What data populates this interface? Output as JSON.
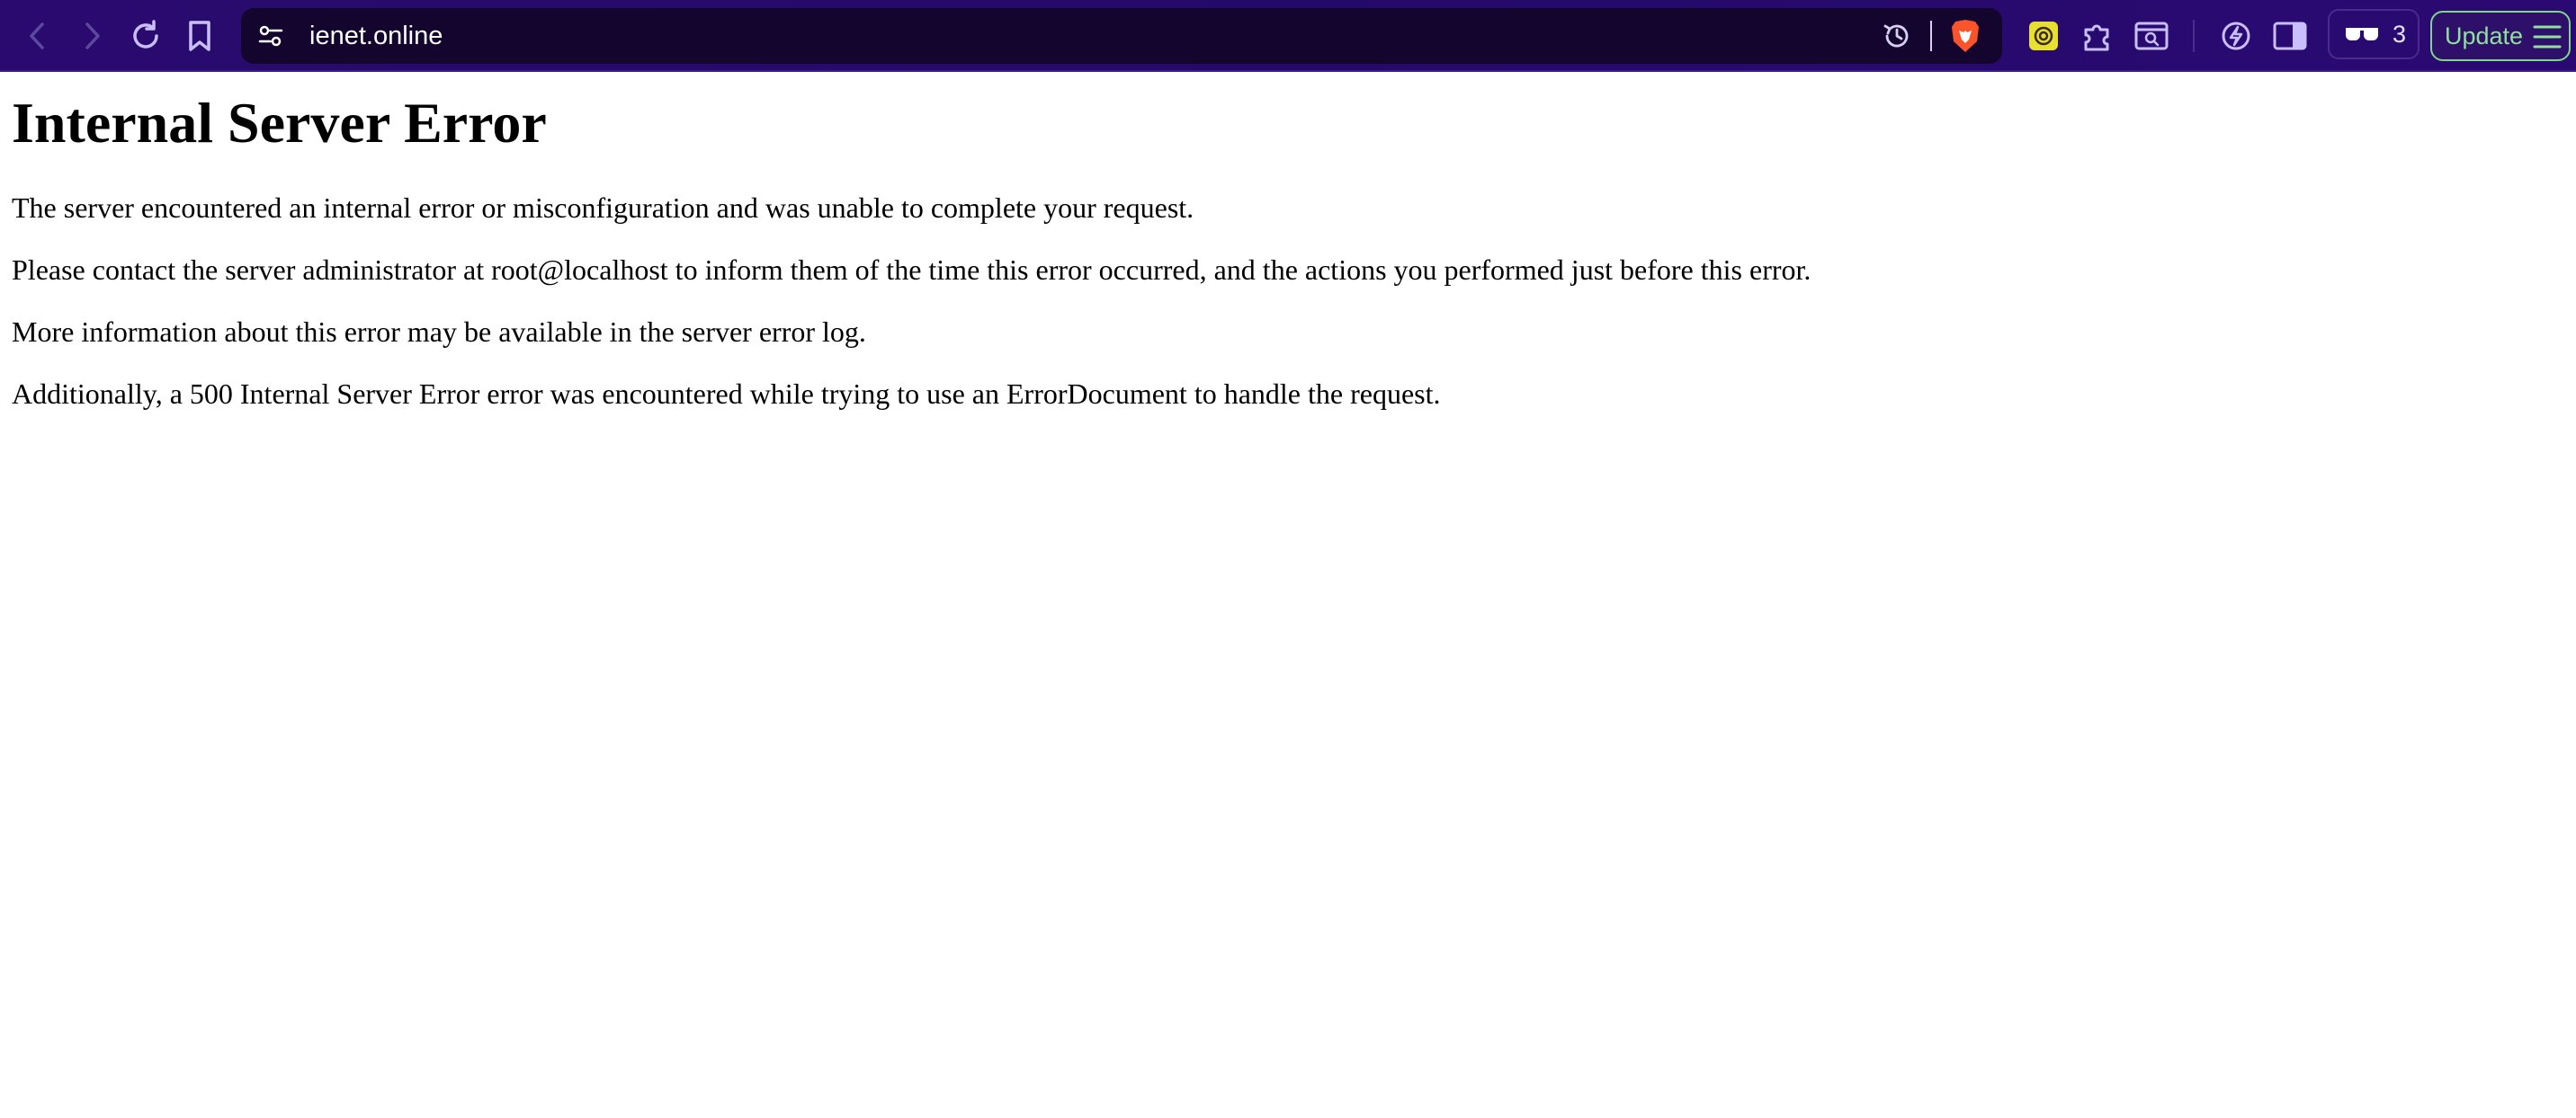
{
  "browser": {
    "url": "ienet.online",
    "icons": {
      "back": "chevron-left-icon",
      "forward": "chevron-right-icon",
      "reload": "reload-icon",
      "bookmark": "bookmark-icon",
      "site_settings": "tune-icon",
      "history": "history-clock-icon",
      "brave_shields": "brave-lion-icon",
      "wallet": "wallet-icon",
      "extensions": "puzzle-icon",
      "screenshot": "screenshot-search-icon",
      "leo": "leo-ai-icon",
      "sidebar": "sidebar-icon",
      "reader": "glasses-icon",
      "menu": "hamburger-icon"
    },
    "reader_count": "3",
    "update_label": "Update",
    "colors": {
      "toolbar": "#2a0a6e",
      "urlbar": "#14052f",
      "update_accent": "#8fe09a",
      "wallet_bg": "#e8e030",
      "brave_orange": "#fb542b"
    }
  },
  "page": {
    "title": "Internal Server Error",
    "paragraphs": [
      "The server encountered an internal error or misconfiguration and was unable to complete your request.",
      "Please contact the server administrator at root@localhost to inform them of the time this error occurred, and the actions you performed just before this error.",
      "More information about this error may be available in the server error log.",
      "Additionally, a 500 Internal Server Error error was encountered while trying to use an ErrorDocument to handle the request."
    ]
  }
}
